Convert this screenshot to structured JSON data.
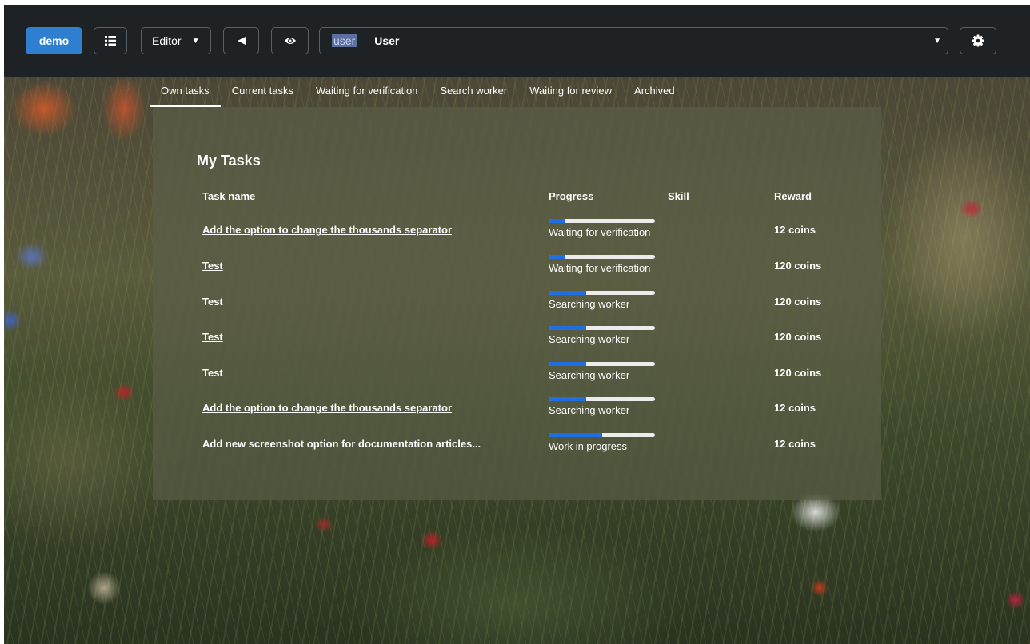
{
  "topbar": {
    "demo_label": "demo",
    "editor_label": "Editor",
    "user_select": {
      "username": "user",
      "full_name": "User"
    },
    "icons": {
      "list": "list-icon",
      "back": "back-arrow-icon",
      "eye": "eye-icon",
      "gear": "gear-icon",
      "caret": "caret-down-icon"
    },
    "accent_color": "#2f7fd1"
  },
  "tabs": [
    {
      "label": "Own tasks",
      "active": true
    },
    {
      "label": "Current tasks",
      "active": false
    },
    {
      "label": "Waiting for verification",
      "active": false
    },
    {
      "label": "Search worker",
      "active": false
    },
    {
      "label": "Waiting for review",
      "active": false
    },
    {
      "label": "Archived",
      "active": false
    }
  ],
  "panel": {
    "title": "My Tasks",
    "columns": {
      "task_name": "Task name",
      "progress": "Progress",
      "skill": "Skill",
      "reward": "Reward"
    },
    "progress_color": "#1f6fe0",
    "rows": [
      {
        "name": "Add the option to change the thousands separator",
        "link": true,
        "progress": 0.15,
        "status": "Waiting for verification",
        "reward": "12 coins"
      },
      {
        "name": "Test",
        "link": true,
        "progress": 0.15,
        "status": "Waiting for verification",
        "reward": "120 coins"
      },
      {
        "name": "Test",
        "link": false,
        "progress": 0.35,
        "status": "Searching worker",
        "reward": "120 coins"
      },
      {
        "name": "Test",
        "link": true,
        "progress": 0.35,
        "status": "Searching worker",
        "reward": "120 coins"
      },
      {
        "name": "Test",
        "link": false,
        "progress": 0.35,
        "status": "Searching worker",
        "reward": "120 coins"
      },
      {
        "name": "Add the option to change the thousands separator",
        "link": true,
        "progress": 0.35,
        "status": "Searching worker",
        "reward": "12 coins"
      },
      {
        "name": "Add new screenshot option for documentation articles...",
        "link": false,
        "progress": 0.5,
        "status": "Work in progress",
        "reward": "12 coins"
      }
    ]
  }
}
